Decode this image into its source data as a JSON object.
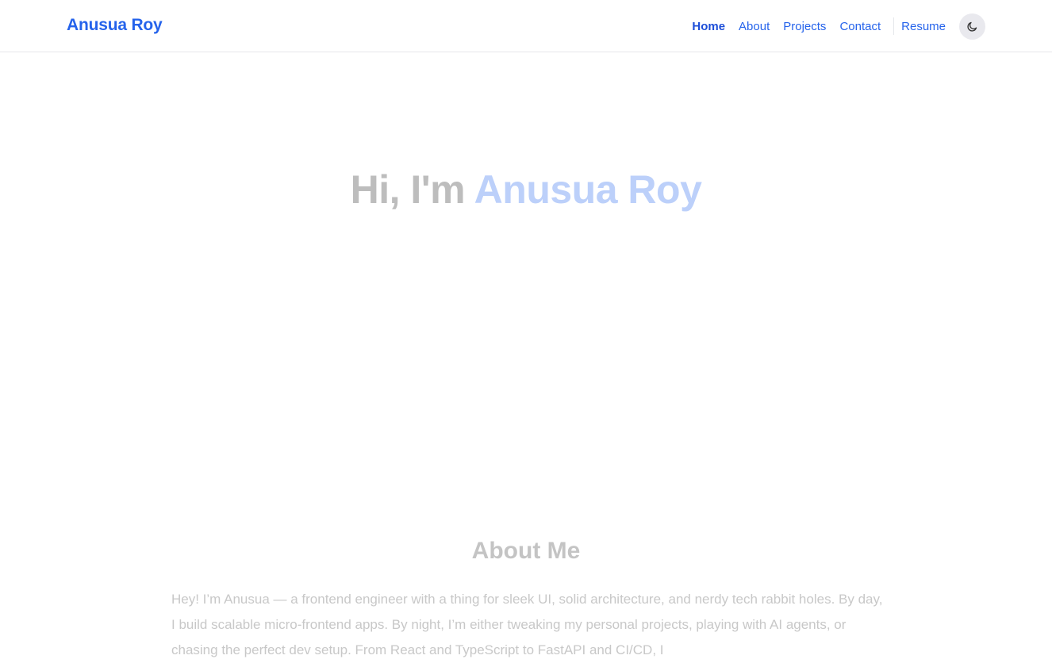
{
  "nav": {
    "brand": "Anusua Roy",
    "links": [
      {
        "label": "Home",
        "active": true
      },
      {
        "label": "About"
      },
      {
        "label": "Projects"
      },
      {
        "label": "Contact"
      }
    ],
    "resume_label": "Resume",
    "theme_toggle_icon": "moon-icon"
  },
  "hero": {
    "greeting": "Hi, I'm ",
    "name": "Anusua Roy"
  },
  "about": {
    "title": "About Me",
    "text": "Hey! I’m Anusua — a frontend engineer with a thing for sleek UI, solid architecture, and nerdy tech rabbit holes. By day, I build scalable micro-frontend apps. By night, I’m either tweaking my personal projects, playing with AI agents, or chasing the perfect dev setup. From React and TypeScript to FastAPI and CI/CD, I"
  },
  "colors": {
    "accent": "#2563eb",
    "hero_name": "#bcd0fa",
    "faded_text": "#bdbdbd"
  }
}
